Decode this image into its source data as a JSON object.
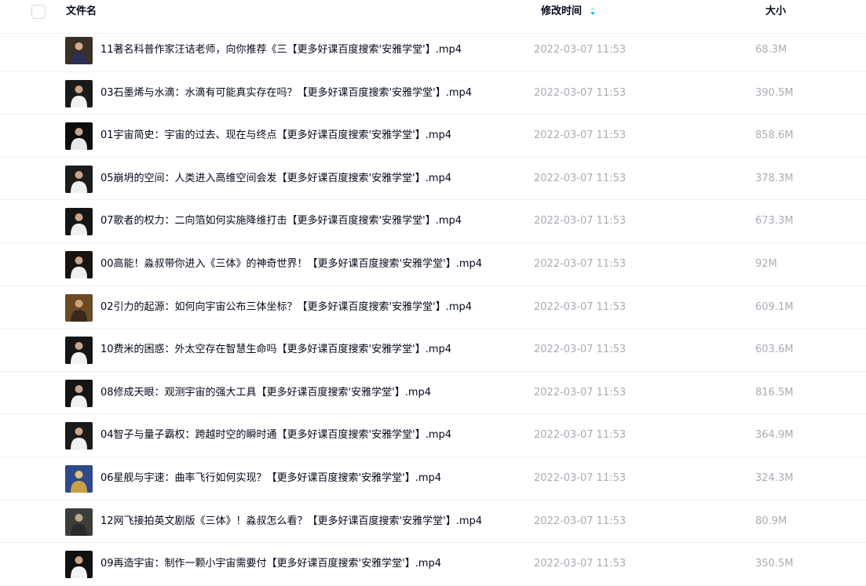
{
  "header": {
    "name_label": "文件名",
    "time_label": "修改时间",
    "size_label": "大小",
    "sort_icon": "sort-descending-icon"
  },
  "files": [
    {
      "name": "11著名科普作家汪诘老师，向你推荐《三【更多好课百度搜索'安雅学堂'】.mp4",
      "time": "2022-03-07 11:53",
      "size": "68.3M",
      "thumb": "video-thumbnail-icon"
    },
    {
      "name": "03石墨烯与水滴：水滴有可能真实存在吗？【更多好课百度搜索'安雅学堂'】.mp4",
      "time": "2022-03-07 11:53",
      "size": "390.5M",
      "thumb": "video-thumbnail-icon"
    },
    {
      "name": "01宇宙简史：宇宙的过去、现在与终点【更多好课百度搜索'安雅学堂'】.mp4",
      "time": "2022-03-07 11:53",
      "size": "858.6M",
      "thumb": "video-thumbnail-icon"
    },
    {
      "name": "05崩坍的空间：人类进入高维空间会发【更多好课百度搜索'安雅学堂'】.mp4",
      "time": "2022-03-07 11:53",
      "size": "378.3M",
      "thumb": "video-thumbnail-icon"
    },
    {
      "name": "07歌者的权力：二向箔如何实施降维打击【更多好课百度搜索'安雅学堂'】.mp4",
      "time": "2022-03-07 11:53",
      "size": "673.3M",
      "thumb": "video-thumbnail-icon"
    },
    {
      "name": "00高能！淼叔带你进入《三体》的神奇世界！【更多好课百度搜索'安雅学堂'】.mp4",
      "time": "2022-03-07 11:53",
      "size": "92M",
      "thumb": "video-thumbnail-icon"
    },
    {
      "name": "02引力的起源：如何向宇宙公布三体坐标？【更多好课百度搜索'安雅学堂'】.mp4",
      "time": "2022-03-07 11:53",
      "size": "609.1M",
      "thumb": "video-thumbnail-icon"
    },
    {
      "name": "10费米的困惑：外太空存在智慧生命吗【更多好课百度搜索'安雅学堂'】.mp4",
      "time": "2022-03-07 11:53",
      "size": "603.6M",
      "thumb": "video-thumbnail-icon"
    },
    {
      "name": "08修成天眼：观测宇宙的强大工具【更多好课百度搜索'安雅学堂'】.mp4",
      "time": "2022-03-07 11:53",
      "size": "816.5M",
      "thumb": "video-thumbnail-icon"
    },
    {
      "name": "04智子与量子霸权：跨越时空的瞬时通【更多好课百度搜索'安雅学堂'】.mp4",
      "time": "2022-03-07 11:53",
      "size": "364.9M",
      "thumb": "video-thumbnail-icon"
    },
    {
      "name": "06星舰与宇速：曲率飞行如何实现？【更多好课百度搜索'安雅学堂'】.mp4",
      "time": "2022-03-07 11:53",
      "size": "324.3M",
      "thumb": "video-thumbnail-icon"
    },
    {
      "name": "12网飞接拍英文剧版《三体》！淼叔怎么看？【更多好课百度搜索'安雅学堂'】.mp4",
      "time": "2022-03-07 11:53",
      "size": "80.9M",
      "thumb": "video-thumbnail-icon"
    },
    {
      "name": "09再造宇宙：制作一颗小宇宙需要付【更多好课百度搜索'安雅学堂'】.mp4",
      "time": "2022-03-07 11:53",
      "size": "350.5M",
      "thumb": "video-thumbnail-icon"
    }
  ],
  "colors": {
    "primary_text": "#03081a",
    "secondary_text": "#a9acb5",
    "divider": "#f1f2f4",
    "sort_accent": "#06a7ff"
  }
}
